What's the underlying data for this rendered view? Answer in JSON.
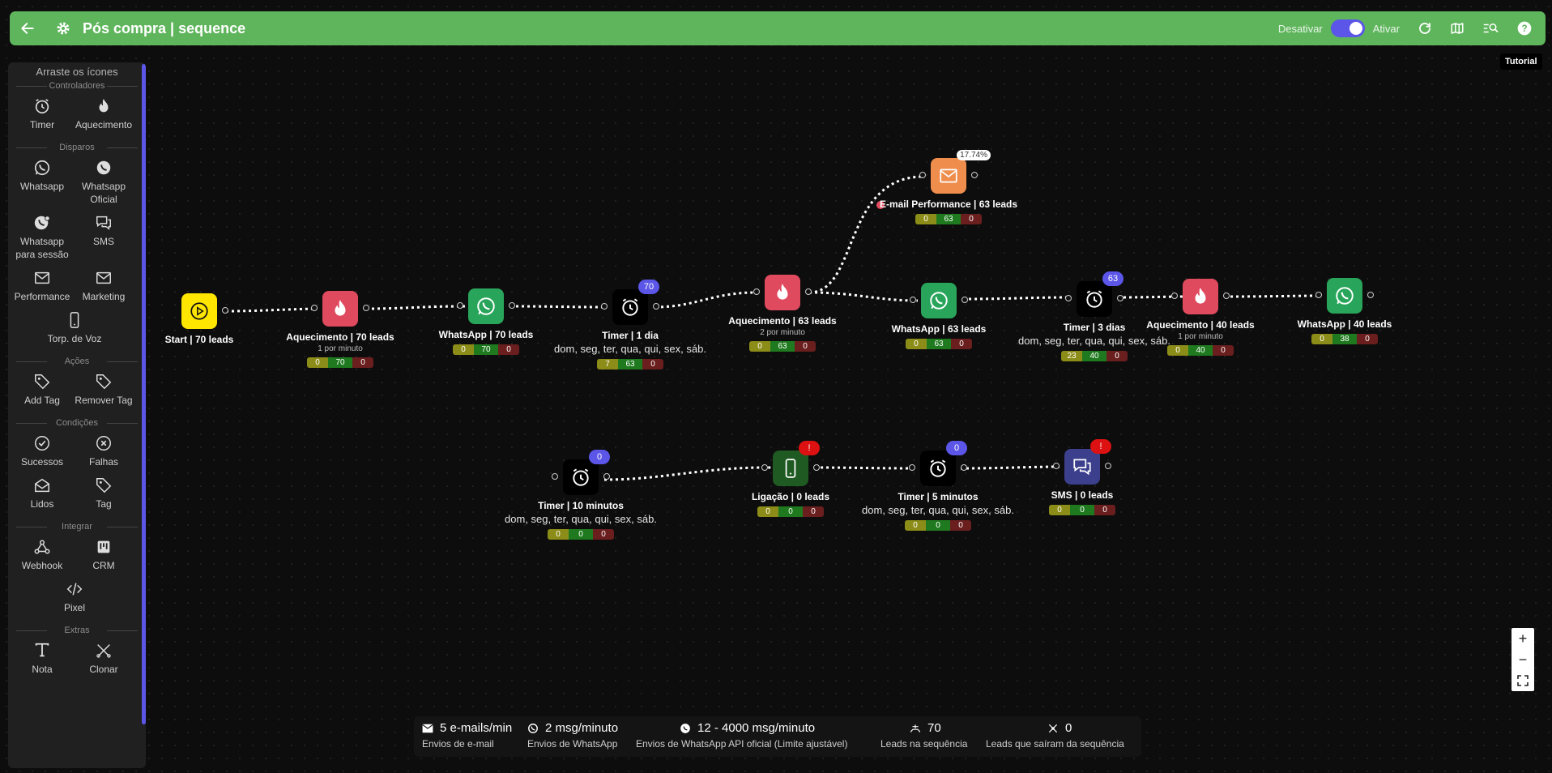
{
  "header": {
    "title": "Pós compra | sequence",
    "deactivate_label": "Desativar",
    "activate_label": "Ativar",
    "tooltip": "Tutorial"
  },
  "sidebar": {
    "heading": "Arraste os ícones",
    "sections": {
      "controladores": "Controladores",
      "disparos": "Disparos",
      "acoes": "Ações",
      "condicoes": "Condições",
      "integrar": "Integrar",
      "extras": "Extras"
    },
    "items": {
      "timer": "Timer",
      "aquecimento": "Aquecimento",
      "whatsapp": "Whatsapp",
      "whatsapp_oficial": "Whatsapp Oficial",
      "whatsapp_sessao": "Whatsapp para sessão",
      "sms": "SMS",
      "performance": "Performance",
      "marketing": "Marketing",
      "torp_voz": "Torp. de Voz",
      "add_tag": "Add Tag",
      "remover_tag": "Remover Tag",
      "sucessos": "Sucessos",
      "falhas": "Falhas",
      "lidos": "Lidos",
      "tag": "Tag",
      "webhook": "Webhook",
      "crm": "CRM",
      "pixel": "Pixel",
      "nota": "Nota",
      "clonar": "Clonar"
    }
  },
  "nodes": {
    "start": {
      "name": "Start | 70 leads"
    },
    "aq1": {
      "name": "Aquecimento | 70 leads",
      "sub": "1 por minuto",
      "stats": [
        "0",
        "70",
        "0"
      ]
    },
    "wa1": {
      "name": "WhatsApp | 70 leads",
      "stats": [
        "0",
        "70",
        "0"
      ]
    },
    "t1": {
      "name": "Timer | 1 dia",
      "days": "dom, seg, ter, qua, qui, sex, sáb.",
      "badge": "70",
      "stats": [
        "7",
        "63",
        "0"
      ]
    },
    "aq2": {
      "name": "Aquecimento | 63 leads",
      "sub": "2 por minuto",
      "stats": [
        "0",
        "63",
        "0"
      ]
    },
    "email": {
      "name": "E-mail Performance | 63 leads",
      "pct": "17.74%",
      "stats": [
        "0",
        "63",
        "0"
      ]
    },
    "wa2": {
      "name": "WhatsApp | 63 leads",
      "stats": [
        "0",
        "63",
        "0"
      ]
    },
    "t3": {
      "name": "Timer | 3 dias",
      "days": "dom, seg, ter, qua, qui, sex, sáb.",
      "badge": "63",
      "stats": [
        "23",
        "40",
        "0"
      ]
    },
    "aq3": {
      "name": "Aquecimento | 40 leads",
      "sub": "1 por minuto",
      "stats": [
        "0",
        "40",
        "0"
      ]
    },
    "wa3": {
      "name": "WhatsApp | 40 leads",
      "stats": [
        "0",
        "38",
        "0"
      ]
    },
    "t10": {
      "name": "Timer | 10 minutos",
      "days": "dom, seg, ter, qua, qui, sex, sáb.",
      "badge": "0",
      "stats": [
        "0",
        "0",
        "0"
      ]
    },
    "lig": {
      "name": "Ligação | 0 leads",
      "badge": "!",
      "stats": [
        "0",
        "0",
        "0"
      ]
    },
    "t5": {
      "name": "Timer | 5 minutos",
      "days": "dom, seg, ter, qua, qui, sex, sáb.",
      "badge": "0",
      "stats": [
        "0",
        "0",
        "0"
      ]
    },
    "sms": {
      "name": "SMS | 0 leads",
      "badge": "!",
      "stats": [
        "0",
        "0",
        "0"
      ]
    }
  },
  "metrics": [
    {
      "value": "5 e-mails/min",
      "caption": "Envios de e-mail"
    },
    {
      "value": "2 msg/minuto",
      "caption": "Envios de WhatsApp"
    },
    {
      "value": "12 - 4000 msg/minuto",
      "caption": "Envios de WhatsApp API oficial (Limite ajustável)"
    },
    {
      "value": "70",
      "caption": "Leads na sequência"
    },
    {
      "value": "0",
      "caption": "Leads que saíram da sequência"
    }
  ],
  "colors": {
    "header": "#5fb55c",
    "accent": "#5b56e8",
    "fire": "#e04a5e",
    "whatsapp": "#28a55a",
    "email": "#ef8d4c",
    "start": "#ffe600",
    "call": "#1e5a22",
    "sms": "#3b3f8c"
  }
}
